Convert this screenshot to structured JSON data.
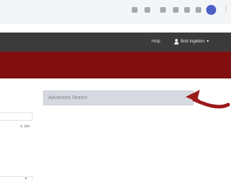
{
  "browser": {
    "icons": [
      "bookmark-icon",
      "extension-icon",
      "pin-icon",
      "printer-icon",
      "chat-icon",
      "profile-icon",
      "menu-icon"
    ]
  },
  "header": {
    "help_label": "Help",
    "user_label": "Bob Ingleton"
  },
  "colors": {
    "header_bg": "#3b3b3b",
    "banner_bg": "#820f0f",
    "search_bg": "#d7d9e0",
    "arrow": "#9b1a1a"
  },
  "search": {
    "label": "Advanced Search"
  },
  "left_panel": {
    "note": "s, Jon"
  }
}
